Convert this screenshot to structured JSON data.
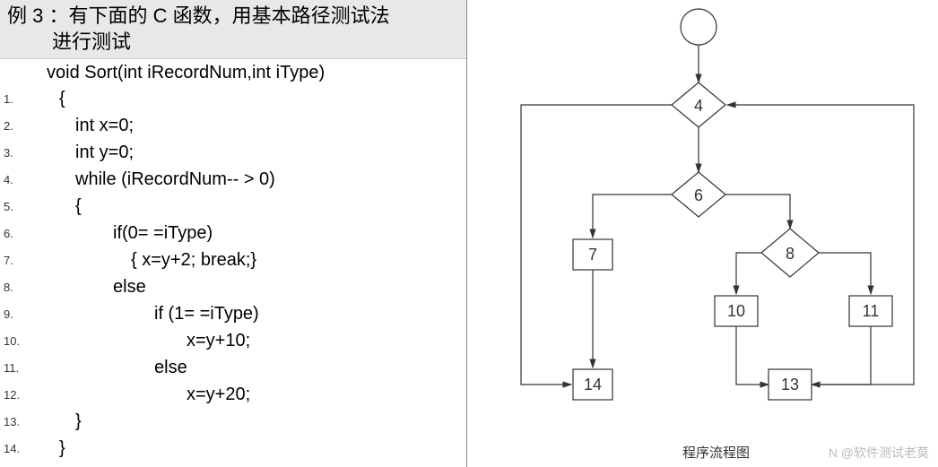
{
  "title": {
    "line1": "例 3 ：有下面的 C 函数，用基本路径测试法",
    "line2": "进行测试"
  },
  "signature": "void  Sort(int iRecordNum,int iType)",
  "code": {
    "l1": {
      "num": "1.",
      "text": "{"
    },
    "l2": {
      "num": "2.",
      "text": "int x=0;"
    },
    "l3": {
      "num": "3.",
      "text": "int y=0;"
    },
    "l4": {
      "num": "4.",
      "text": "while (iRecordNum-- > 0)"
    },
    "l5": {
      "num": "5.",
      "text": "{"
    },
    "l6": {
      "num": "6.",
      "text": "if(0= =iType)"
    },
    "l7": {
      "num": "7.",
      "text": "{ x=y+2; break;}"
    },
    "l8": {
      "num": "8.",
      "text": "else"
    },
    "l9": {
      "num": "9.",
      "text": "if (1= =iType)"
    },
    "l10": {
      "num": "10.",
      "text": "x=y+10;"
    },
    "l11": {
      "num": "11.",
      "text": "else"
    },
    "l12": {
      "num": "12.",
      "text": "x=y+20;"
    },
    "l13": {
      "num": "13.",
      "text": "}"
    },
    "l14": {
      "num": "14.",
      "text": "}"
    }
  },
  "flowchart": {
    "nodes": {
      "n4": "4",
      "n6": "6",
      "n7": "7",
      "n8": "8",
      "n10": "10",
      "n11": "11",
      "n13": "13",
      "n14": "14"
    },
    "caption": "程序流程图"
  },
  "watermark": "N @软件测试老莫"
}
